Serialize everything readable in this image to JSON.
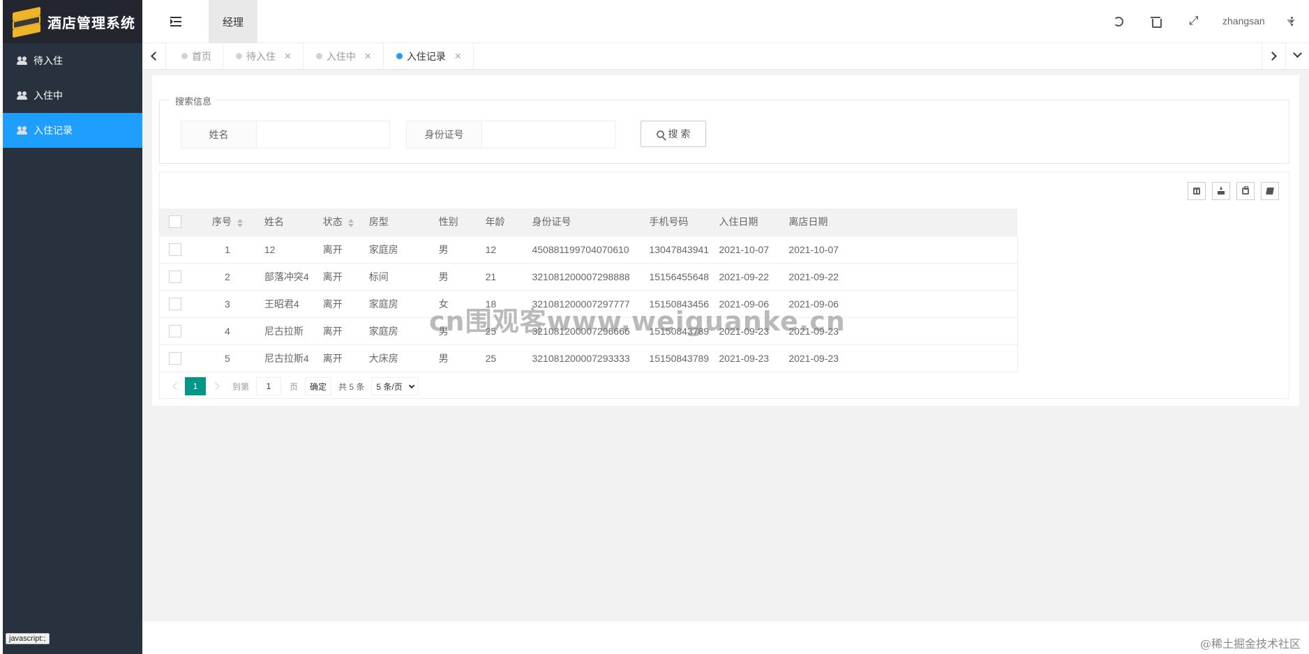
{
  "app": {
    "title": "酒店管理系统"
  },
  "sidebar": {
    "items": [
      {
        "label": "待入住",
        "icon": "users-icon",
        "active": false
      },
      {
        "label": "入住中",
        "icon": "users-icon",
        "active": false
      },
      {
        "label": "入住记录",
        "icon": "users-icon",
        "active": true
      }
    ]
  },
  "header": {
    "role_tab": "经理",
    "username": "zhangsan",
    "icons": [
      "refresh-icon",
      "trash-icon",
      "fullscreen-icon",
      "more-icon"
    ]
  },
  "tabs": [
    {
      "label": "首页",
      "closable": false,
      "active": false
    },
    {
      "label": "待入住",
      "closable": true,
      "active": false
    },
    {
      "label": "入住中",
      "closable": true,
      "active": false
    },
    {
      "label": "入住记录",
      "closable": true,
      "active": true
    }
  ],
  "search": {
    "legend": "搜索信息",
    "name_label": "姓名",
    "name_value": "",
    "id_label": "身份证号",
    "id_value": "",
    "button_label": "搜 索"
  },
  "table": {
    "columns": [
      "序号",
      "姓名",
      "状态",
      "房型",
      "性别",
      "年龄",
      "身份证号",
      "手机号码",
      "入住日期",
      "离店日期"
    ],
    "rows": [
      [
        "1",
        "12",
        "离开",
        "家庭房",
        "男",
        "12",
        "450881199704070610",
        "13047843941",
        "2021-10-07",
        "2021-10-07"
      ],
      [
        "2",
        "部落冲突4",
        "离开",
        "标间",
        "男",
        "21",
        "321081200007298888",
        "15156455648",
        "2021-09-22",
        "2021-09-22"
      ],
      [
        "3",
        "王昭君4",
        "离开",
        "家庭房",
        "女",
        "18",
        "321081200007297777",
        "15150843456",
        "2021-09-06",
        "2021-09-06"
      ],
      [
        "4",
        "尼古拉斯",
        "离开",
        "家庭房",
        "男",
        "25",
        "321081200007296666",
        "15150843789",
        "2021-09-23",
        "2021-09-23"
      ],
      [
        "5",
        "尼古拉斯4",
        "离开",
        "大床房",
        "男",
        "25",
        "321081200007293333",
        "15150843789",
        "2021-09-23",
        "2021-09-23"
      ]
    ]
  },
  "pager": {
    "current": "1",
    "goto_label": "到第",
    "goto_value": "1",
    "page_unit": "页",
    "confirm_label": "确定",
    "count_label": "共 5 条",
    "limit_label": "5 条/页"
  },
  "watermark": "cn围观客www.weiguanke.cn",
  "footer_watermark": "@稀土掘金技术社区",
  "status_bar": "javascript:;",
  "colors": {
    "sidebar": "#28323f",
    "accent": "#1e9fff",
    "pager_active": "#009688"
  }
}
